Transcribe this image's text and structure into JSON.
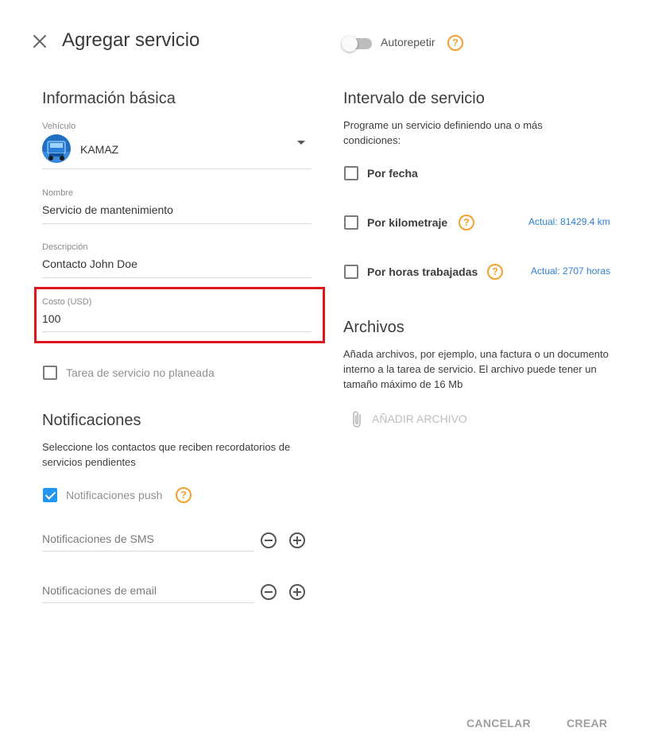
{
  "header": {
    "title": "Agregar servicio",
    "autorepeat_label": "Autorepetir",
    "autorepeat_on": false,
    "help_glyph": "?"
  },
  "basic_info": {
    "title": "Información básica",
    "vehicle": {
      "label": "Vehículo",
      "value": "KAMAZ"
    },
    "name": {
      "label": "Nombre",
      "value": "Servicio de mantenimiento"
    },
    "description": {
      "label": "Descripción",
      "value": "Contacto John Doe"
    },
    "cost": {
      "label": "Costo (USD)",
      "value": "100"
    },
    "unplanned": {
      "label": "Tarea de servicio no planeada",
      "checked": false
    }
  },
  "notifications": {
    "title": "Notificaciones",
    "description": "Seleccione los contactos que reciben recordatorios de servicios pendientes",
    "push": {
      "label": "Notificaciones push",
      "checked": true
    },
    "sms": {
      "placeholder": "Notificaciones de SMS"
    },
    "email": {
      "placeholder": "Notificaciones de email"
    }
  },
  "interval": {
    "title": "Intervalo de servicio",
    "description": "Programe un servicio definiendo una o más condiciones:",
    "by_date": {
      "label": "Por fecha",
      "checked": false
    },
    "by_mileage": {
      "label": "Por kilometraje",
      "checked": false,
      "actual": "Actual: 81429.4 km"
    },
    "by_hours": {
      "label": "Por horas trabajadas",
      "checked": false,
      "actual": "Actual: 2707 horas"
    }
  },
  "files": {
    "title": "Archivos",
    "description": "Añada archivos, por ejemplo, una factura o un documento interno a la tarea de servicio. El archivo puede tener un tamaño máximo de 16 Mb",
    "add_label": "AÑADIR ARCHIVO"
  },
  "footer": {
    "cancel_label": "CANCELAR",
    "create_label": "CREAR"
  },
  "icons": {
    "close": "close-icon",
    "help": "help-circle-icon",
    "caret": "caret-down-icon",
    "minus": "minus-circle-icon",
    "plus": "plus-circle-icon",
    "attach": "paperclip-icon"
  },
  "colors": {
    "accent": "#2196f3",
    "help": "#f5a02c",
    "link": "#2f7fd0",
    "highlight": "#e0151b"
  }
}
